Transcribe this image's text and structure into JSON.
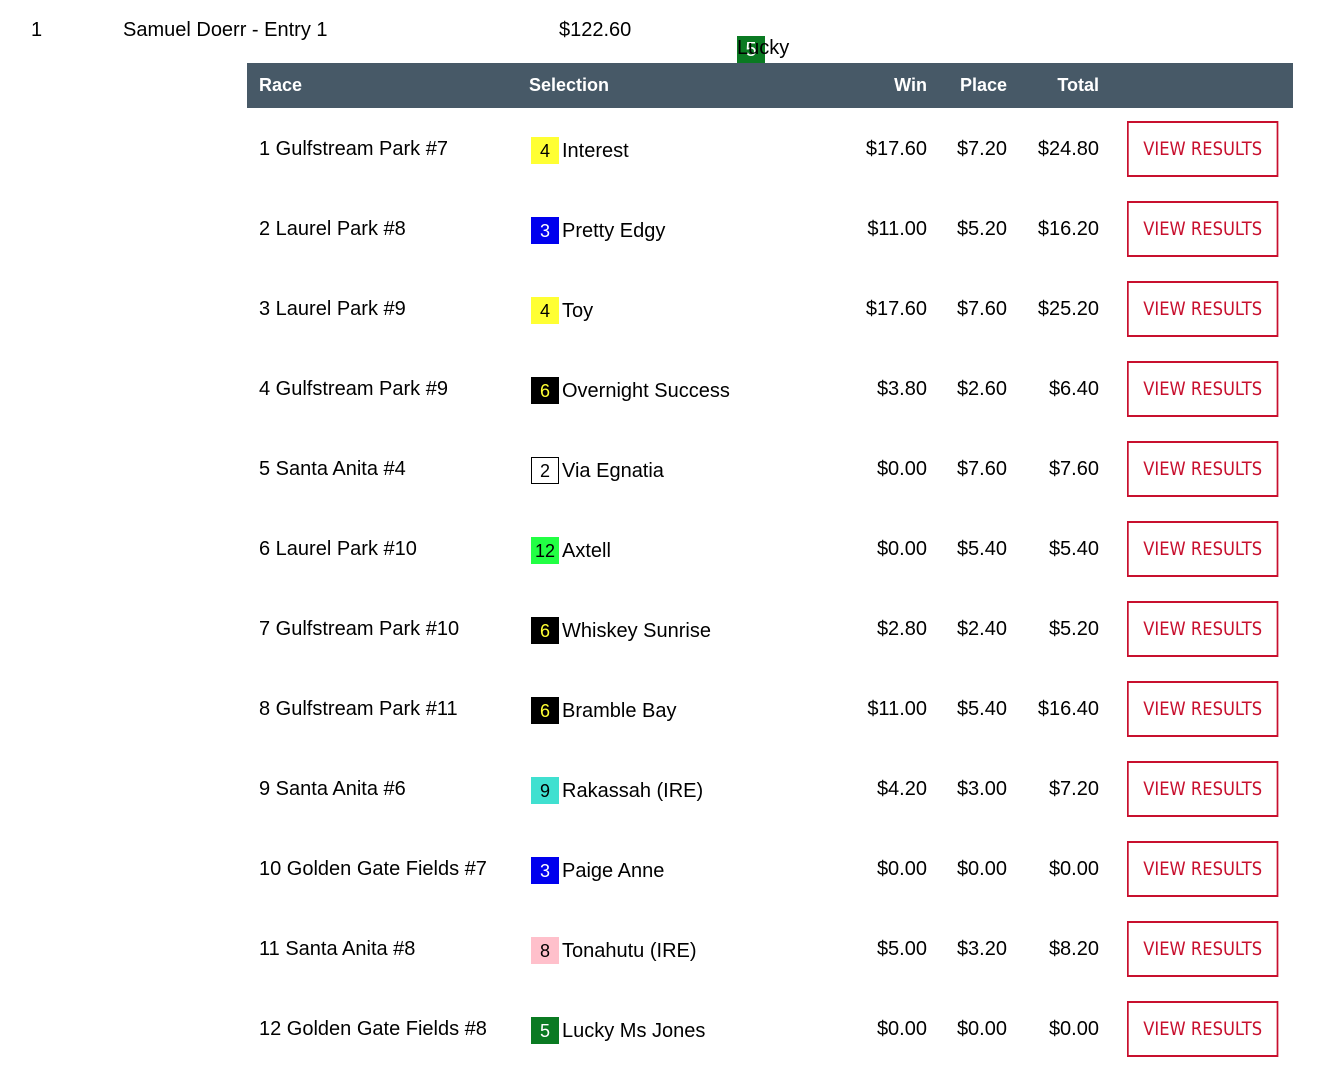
{
  "entry": {
    "rank": "1",
    "player": "Samuel Doerr - Entry 1",
    "total": "$122.60",
    "horse": {
      "number": "5",
      "name": "Lucky Ms Jones",
      "bg": "#0a7a22",
      "fg": "#ffffff",
      "border": ""
    }
  },
  "table": {
    "headers": {
      "race": "Race",
      "selection": "Selection",
      "win": "Win",
      "place": "Place",
      "total": "Total"
    },
    "header_bg": "#475967",
    "button_label": "VIEW RESULTS",
    "button_color": "#c8102e",
    "rows": [
      {
        "race": "1 Gulfstream Park #7",
        "pp": "4",
        "bg": "#ffff33",
        "fg": "#000000",
        "border": "",
        "horse": "Interest",
        "win": "$17.60",
        "place": "$7.20",
        "total": "$24.80"
      },
      {
        "race": "2 Laurel Park #8",
        "pp": "3",
        "bg": "#0000ee",
        "fg": "#ffffff",
        "border": "",
        "horse": "Pretty Edgy",
        "win": "$11.00",
        "place": "$5.20",
        "total": "$16.20"
      },
      {
        "race": "3 Laurel Park #9",
        "pp": "4",
        "bg": "#ffff33",
        "fg": "#000000",
        "border": "",
        "horse": "Toy",
        "win": "$17.60",
        "place": "$7.60",
        "total": "$25.20"
      },
      {
        "race": "4 Gulfstream Park #9",
        "pp": "6",
        "bg": "#000000",
        "fg": "#ffff33",
        "border": "",
        "horse": "Overnight Success",
        "win": "$3.80",
        "place": "$2.60",
        "total": "$6.40"
      },
      {
        "race": "5 Santa Anita #4",
        "pp": "2",
        "bg": "#ffffff",
        "fg": "#000000",
        "border": "#000000",
        "horse": "Via Egnatia",
        "win": "$0.00",
        "place": "$7.60",
        "total": "$7.60"
      },
      {
        "race": "6 Laurel Park #10",
        "pp": "12",
        "bg": "#22ff44",
        "fg": "#000000",
        "border": "",
        "horse": "Axtell",
        "win": "$0.00",
        "place": "$5.40",
        "total": "$5.40"
      },
      {
        "race": "7 Gulfstream Park #10",
        "pp": "6",
        "bg": "#000000",
        "fg": "#ffff33",
        "border": "",
        "horse": "Whiskey Sunrise",
        "win": "$2.80",
        "place": "$2.40",
        "total": "$5.20"
      },
      {
        "race": "8 Gulfstream Park #11",
        "pp": "6",
        "bg": "#000000",
        "fg": "#ffff33",
        "border": "",
        "horse": "Bramble Bay",
        "win": "$11.00",
        "place": "$5.40",
        "total": "$16.40"
      },
      {
        "race": "9 Santa Anita #6",
        "pp": "9",
        "bg": "#40e0d0",
        "fg": "#000000",
        "border": "",
        "horse": "Rakassah (IRE)",
        "win": "$4.20",
        "place": "$3.00",
        "total": "$7.20"
      },
      {
        "race": "10 Golden Gate Fields #7",
        "pp": "3",
        "bg": "#0000ee",
        "fg": "#ffffff",
        "border": "",
        "horse": "Paige Anne",
        "win": "$0.00",
        "place": "$0.00",
        "total": "$0.00"
      },
      {
        "race": "11 Santa Anita #8",
        "pp": "8",
        "bg": "#ffc0cb",
        "fg": "#000000",
        "border": "",
        "horse": "Tonahutu (IRE)",
        "win": "$5.00",
        "place": "$3.20",
        "total": "$8.20"
      },
      {
        "race": "12 Golden Gate Fields #8",
        "pp": "5",
        "bg": "#0a7a22",
        "fg": "#ffffff",
        "border": "",
        "horse": "Lucky Ms Jones",
        "win": "$0.00",
        "place": "$0.00",
        "total": "$0.00"
      }
    ]
  }
}
